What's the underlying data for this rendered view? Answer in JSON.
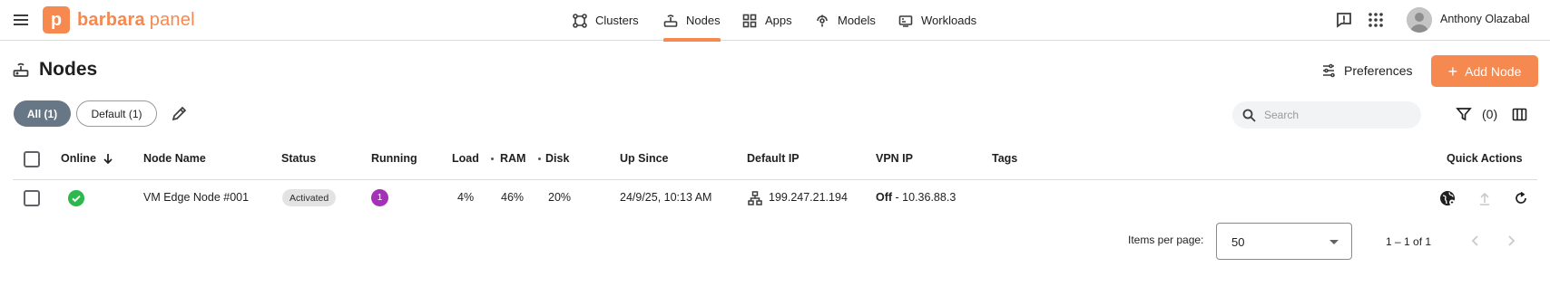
{
  "brand": {
    "letter": "p",
    "name": "barbara",
    "suffix": "panel",
    "accent": "#f5894f"
  },
  "nav": [
    {
      "label": "Clusters",
      "icon": "clusters-icon",
      "active": false
    },
    {
      "label": "Nodes",
      "icon": "nodes-icon",
      "active": true
    },
    {
      "label": "Apps",
      "icon": "apps-icon",
      "active": false
    },
    {
      "label": "Models",
      "icon": "models-icon",
      "active": false
    },
    {
      "label": "Workloads",
      "icon": "workloads-icon",
      "active": false
    }
  ],
  "user": {
    "name": "Anthony Olazabal"
  },
  "page": {
    "title": "Nodes",
    "preferences_label": "Preferences",
    "add_label": "Add Node"
  },
  "filters": {
    "chips": [
      {
        "label": "All (1)",
        "active": true
      },
      {
        "label": "Default (1)",
        "active": false
      }
    ],
    "search_placeholder": "Search",
    "filter_count": "(0)"
  },
  "table": {
    "columns": [
      "Online",
      "Node Name",
      "Status",
      "Running",
      "Load",
      "RAM",
      "Disk",
      "Up Since",
      "Default IP",
      "VPN IP",
      "Tags",
      "Quick Actions"
    ],
    "rows": [
      {
        "online": true,
        "node_name": "VM Edge Node #001",
        "status": "Activated",
        "running": "1",
        "load": "4%",
        "ram": "46%",
        "disk": "20%",
        "up_since": "24/9/25, 10:13 AM",
        "default_ip": "199.247.21.194",
        "vpn_state": "Off",
        "vpn_ip": "- 10.36.88.3",
        "tags": ""
      }
    ]
  },
  "paginator": {
    "items_per_page_label": "Items per page:",
    "items_per_page": "50",
    "range": "1 – 1 of 1"
  },
  "colors": {
    "online_green": "#2db84d",
    "running_purple": "#a431b7",
    "chip_active": "#677786"
  }
}
